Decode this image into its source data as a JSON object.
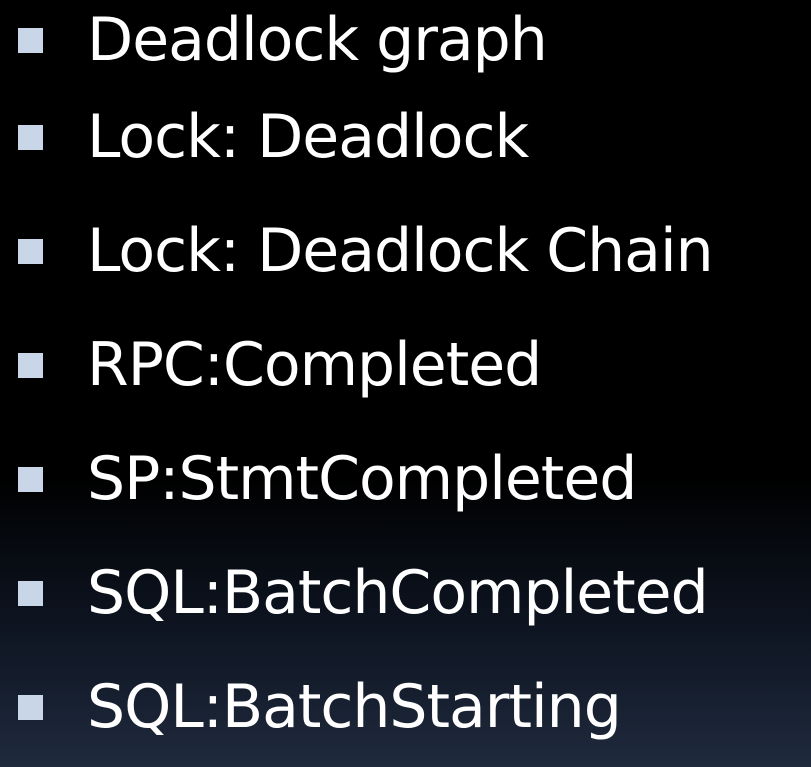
{
  "slide": {
    "bullets": [
      {
        "text": "Deadlock graph"
      },
      {
        "text": "Lock: Deadlock"
      },
      {
        "text": "Lock: Deadlock Chain"
      },
      {
        "text": "RPC:Completed"
      },
      {
        "text": "SP:StmtCompleted"
      },
      {
        "text": "SQL:BatchCompleted"
      },
      {
        "text": "SQL:BatchStarting"
      }
    ],
    "colors": {
      "background": "#000000",
      "text": "#ffffff",
      "bullet": "#c9d6e8"
    }
  }
}
